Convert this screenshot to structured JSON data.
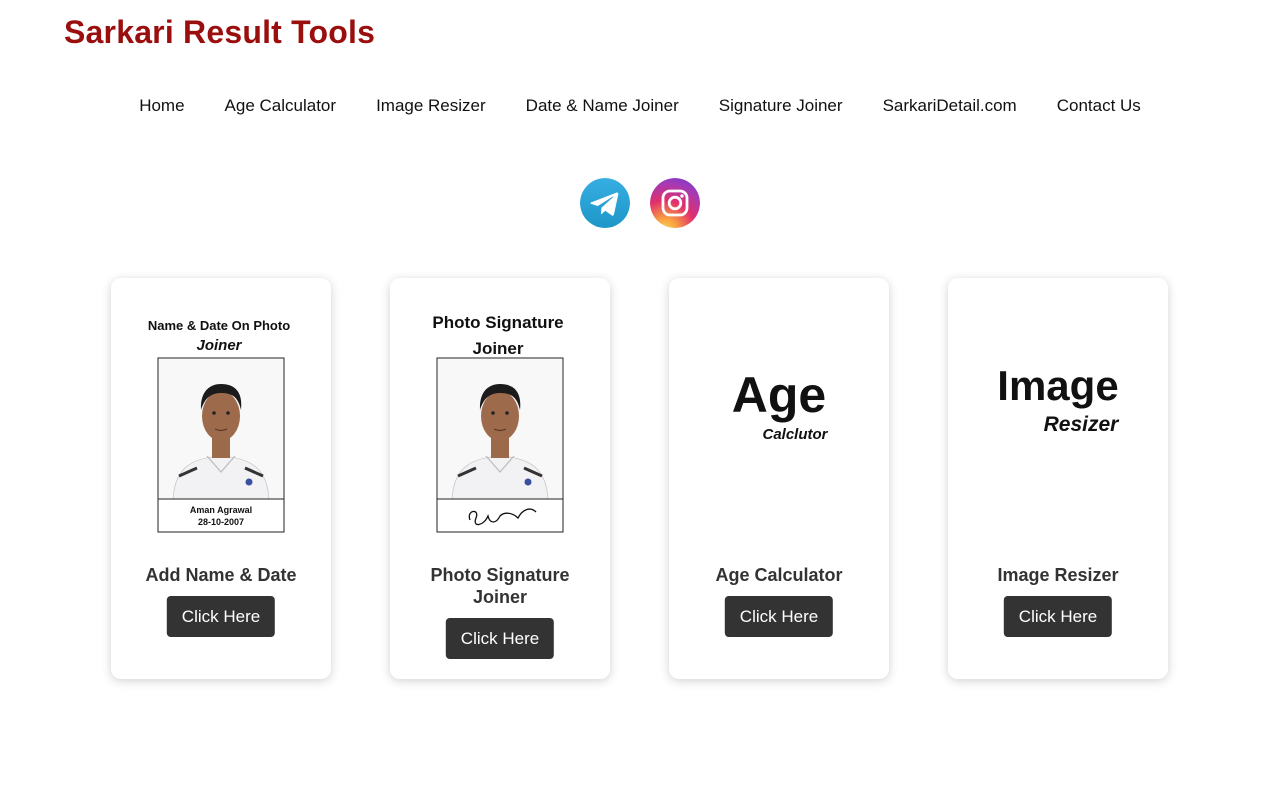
{
  "site": {
    "title": "Sarkari Result Tools"
  },
  "nav": {
    "items": [
      {
        "label": "Home"
      },
      {
        "label": "Age Calculator"
      },
      {
        "label": "Image Resizer"
      },
      {
        "label": "Date & Name Joiner"
      },
      {
        "label": "Signature Joiner"
      },
      {
        "label": "SarkariDetail.com"
      },
      {
        "label": "Contact Us"
      }
    ]
  },
  "social": {
    "icons": [
      "telegram-icon",
      "instagram-icon"
    ],
    "colors": {
      "telegram": "#2aa3df",
      "instagram_start": "#f9c34a",
      "instagram_mid": "#e1306c",
      "instagram_end": "#833ab4"
    }
  },
  "cards": [
    {
      "title": "Add Name & Date",
      "button": "Click Here",
      "thumb": {
        "line1": "Name & Date On Photo",
        "line2": "Joiner",
        "name": "Aman Agrawal",
        "date": "28-10-2007"
      }
    },
    {
      "title": "Photo Signature Joiner",
      "button": "Click Here",
      "thumb": {
        "line1": "Photo Signature",
        "line2": "Joiner"
      }
    },
    {
      "title": "Age Calculator",
      "button": "Click Here",
      "thumb": {
        "line1": "Age",
        "line2": "Calclutor"
      }
    },
    {
      "title": "Image Resizer",
      "button": "Click Here",
      "thumb": {
        "line1": "Image",
        "line2": "Resizer"
      }
    }
  ],
  "colors": {
    "title": "#9b0e0e",
    "button_bg": "#333333",
    "button_text": "#ffffff"
  }
}
